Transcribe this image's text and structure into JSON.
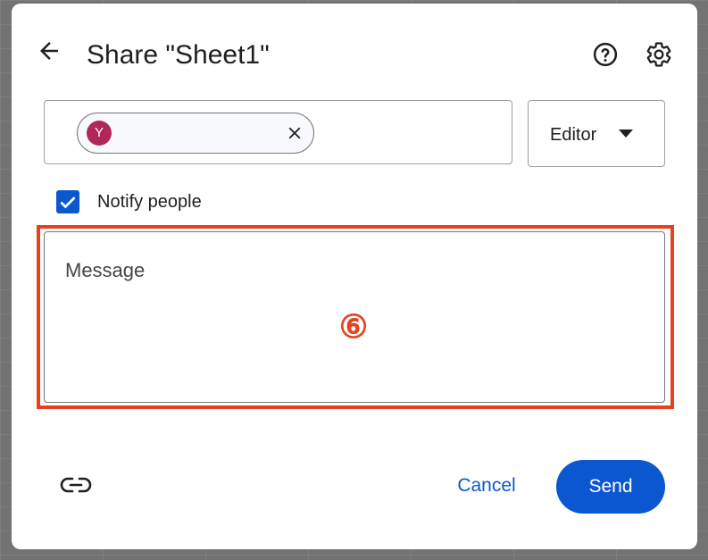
{
  "dialog": {
    "title": "Share \"Sheet1\"",
    "icons": {
      "back": "arrow-back-icon",
      "help": "help-circle-icon",
      "settings": "gear-icon"
    }
  },
  "recipients": {
    "chip": {
      "avatar_initial": "Y",
      "avatar_color": "#b0285a",
      "close_icon": "close-icon"
    }
  },
  "role": {
    "label": "Editor",
    "caret_icon": "caret-down-icon"
  },
  "notify": {
    "label": "Notify people",
    "checked": true
  },
  "message": {
    "placeholder": "Message",
    "annotation_marker": "⑥",
    "highlight_color": "#e8401f"
  },
  "footer": {
    "link_icon": "link-icon",
    "cancel_label": "Cancel",
    "send_label": "Send"
  },
  "colors": {
    "accent": "#0b57d0",
    "text": "#1f1f1f"
  }
}
